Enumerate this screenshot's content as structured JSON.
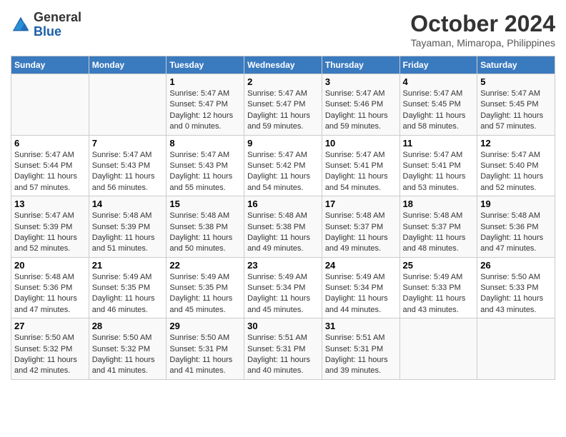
{
  "header": {
    "logo_line1": "General",
    "logo_line2": "Blue",
    "month": "October 2024",
    "location": "Tayaman, Mimaropa, Philippines"
  },
  "weekdays": [
    "Sunday",
    "Monday",
    "Tuesday",
    "Wednesday",
    "Thursday",
    "Friday",
    "Saturday"
  ],
  "weeks": [
    [
      {
        "day": "",
        "info": ""
      },
      {
        "day": "",
        "info": ""
      },
      {
        "day": "1",
        "info": "Sunrise: 5:47 AM\nSunset: 5:47 PM\nDaylight: 12 hours and 0 minutes."
      },
      {
        "day": "2",
        "info": "Sunrise: 5:47 AM\nSunset: 5:47 PM\nDaylight: 11 hours and 59 minutes."
      },
      {
        "day": "3",
        "info": "Sunrise: 5:47 AM\nSunset: 5:46 PM\nDaylight: 11 hours and 59 minutes."
      },
      {
        "day": "4",
        "info": "Sunrise: 5:47 AM\nSunset: 5:45 PM\nDaylight: 11 hours and 58 minutes."
      },
      {
        "day": "5",
        "info": "Sunrise: 5:47 AM\nSunset: 5:45 PM\nDaylight: 11 hours and 57 minutes."
      }
    ],
    [
      {
        "day": "6",
        "info": "Sunrise: 5:47 AM\nSunset: 5:44 PM\nDaylight: 11 hours and 57 minutes."
      },
      {
        "day": "7",
        "info": "Sunrise: 5:47 AM\nSunset: 5:43 PM\nDaylight: 11 hours and 56 minutes."
      },
      {
        "day": "8",
        "info": "Sunrise: 5:47 AM\nSunset: 5:43 PM\nDaylight: 11 hours and 55 minutes."
      },
      {
        "day": "9",
        "info": "Sunrise: 5:47 AM\nSunset: 5:42 PM\nDaylight: 11 hours and 54 minutes."
      },
      {
        "day": "10",
        "info": "Sunrise: 5:47 AM\nSunset: 5:41 PM\nDaylight: 11 hours and 54 minutes."
      },
      {
        "day": "11",
        "info": "Sunrise: 5:47 AM\nSunset: 5:41 PM\nDaylight: 11 hours and 53 minutes."
      },
      {
        "day": "12",
        "info": "Sunrise: 5:47 AM\nSunset: 5:40 PM\nDaylight: 11 hours and 52 minutes."
      }
    ],
    [
      {
        "day": "13",
        "info": "Sunrise: 5:47 AM\nSunset: 5:39 PM\nDaylight: 11 hours and 52 minutes."
      },
      {
        "day": "14",
        "info": "Sunrise: 5:48 AM\nSunset: 5:39 PM\nDaylight: 11 hours and 51 minutes."
      },
      {
        "day": "15",
        "info": "Sunrise: 5:48 AM\nSunset: 5:38 PM\nDaylight: 11 hours and 50 minutes."
      },
      {
        "day": "16",
        "info": "Sunrise: 5:48 AM\nSunset: 5:38 PM\nDaylight: 11 hours and 49 minutes."
      },
      {
        "day": "17",
        "info": "Sunrise: 5:48 AM\nSunset: 5:37 PM\nDaylight: 11 hours and 49 minutes."
      },
      {
        "day": "18",
        "info": "Sunrise: 5:48 AM\nSunset: 5:37 PM\nDaylight: 11 hours and 48 minutes."
      },
      {
        "day": "19",
        "info": "Sunrise: 5:48 AM\nSunset: 5:36 PM\nDaylight: 11 hours and 47 minutes."
      }
    ],
    [
      {
        "day": "20",
        "info": "Sunrise: 5:48 AM\nSunset: 5:36 PM\nDaylight: 11 hours and 47 minutes."
      },
      {
        "day": "21",
        "info": "Sunrise: 5:49 AM\nSunset: 5:35 PM\nDaylight: 11 hours and 46 minutes."
      },
      {
        "day": "22",
        "info": "Sunrise: 5:49 AM\nSunset: 5:35 PM\nDaylight: 11 hours and 45 minutes."
      },
      {
        "day": "23",
        "info": "Sunrise: 5:49 AM\nSunset: 5:34 PM\nDaylight: 11 hours and 45 minutes."
      },
      {
        "day": "24",
        "info": "Sunrise: 5:49 AM\nSunset: 5:34 PM\nDaylight: 11 hours and 44 minutes."
      },
      {
        "day": "25",
        "info": "Sunrise: 5:49 AM\nSunset: 5:33 PM\nDaylight: 11 hours and 43 minutes."
      },
      {
        "day": "26",
        "info": "Sunrise: 5:50 AM\nSunset: 5:33 PM\nDaylight: 11 hours and 43 minutes."
      }
    ],
    [
      {
        "day": "27",
        "info": "Sunrise: 5:50 AM\nSunset: 5:32 PM\nDaylight: 11 hours and 42 minutes."
      },
      {
        "day": "28",
        "info": "Sunrise: 5:50 AM\nSunset: 5:32 PM\nDaylight: 11 hours and 41 minutes."
      },
      {
        "day": "29",
        "info": "Sunrise: 5:50 AM\nSunset: 5:31 PM\nDaylight: 11 hours and 41 minutes."
      },
      {
        "day": "30",
        "info": "Sunrise: 5:51 AM\nSunset: 5:31 PM\nDaylight: 11 hours and 40 minutes."
      },
      {
        "day": "31",
        "info": "Sunrise: 5:51 AM\nSunset: 5:31 PM\nDaylight: 11 hours and 39 minutes."
      },
      {
        "day": "",
        "info": ""
      },
      {
        "day": "",
        "info": ""
      }
    ]
  ]
}
